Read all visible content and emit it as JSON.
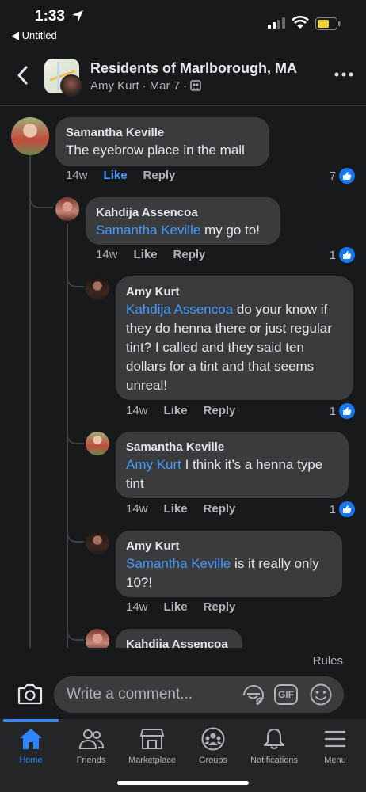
{
  "status_bar": {
    "time": "1:33",
    "back_app": "◀ Untitled"
  },
  "header": {
    "group_name": "Residents of Marlborough, MA",
    "poster": "Amy Kurt",
    "date": "Mar 7",
    "separator": "·"
  },
  "comments": [
    {
      "author": "Samantha Keville",
      "mention": "",
      "text": "The eyebrow place in the mall",
      "age": "14w",
      "like": "Like",
      "reply": "Reply",
      "reactions": "7",
      "liked": true
    },
    {
      "author": "Kahdija Assencoa",
      "mention": "Samantha Keville",
      "text": " my go to!",
      "age": "14w",
      "like": "Like",
      "reply": "Reply",
      "reactions": "1"
    },
    {
      "author": "Amy Kurt",
      "mention": "Kahdija Assencoa",
      "text": " do your know if they do henna there or just regular tint? I called and they said ten dollars for a tint and that seems unreal!",
      "age": "14w",
      "like": "Like",
      "reply": "Reply",
      "reactions": "1"
    },
    {
      "author": "Samantha Keville",
      "mention": "Amy Kurt",
      "text": " I think it’s a henna type tint",
      "age": "14w",
      "like": "Like",
      "reply": "Reply",
      "reactions": "1"
    },
    {
      "author": "Amy Kurt",
      "mention": "Samantha Keville",
      "text": " is it really only 10?!",
      "age": "14w",
      "like": "Like",
      "reply": "Reply",
      "reactions": ""
    },
    {
      "author": "Kahdija Assencoa"
    }
  ],
  "rules_label": "Rules",
  "composer": {
    "placeholder": "Write a comment...",
    "gif_label": "GIF"
  },
  "tabs": [
    {
      "label": "Home",
      "icon": "home-icon",
      "active": true
    },
    {
      "label": "Friends",
      "icon": "friends-icon"
    },
    {
      "label": "Marketplace",
      "icon": "marketplace-icon"
    },
    {
      "label": "Groups",
      "icon": "groups-icon"
    },
    {
      "label": "Notifications",
      "icon": "bell-icon"
    },
    {
      "label": "Menu",
      "icon": "menu-icon"
    }
  ],
  "colors": {
    "background": "#18191a",
    "bubble": "#3a3b3c",
    "mention": "#4599ff",
    "accent": "#2d88ff",
    "like_badge": "#1877f2"
  }
}
